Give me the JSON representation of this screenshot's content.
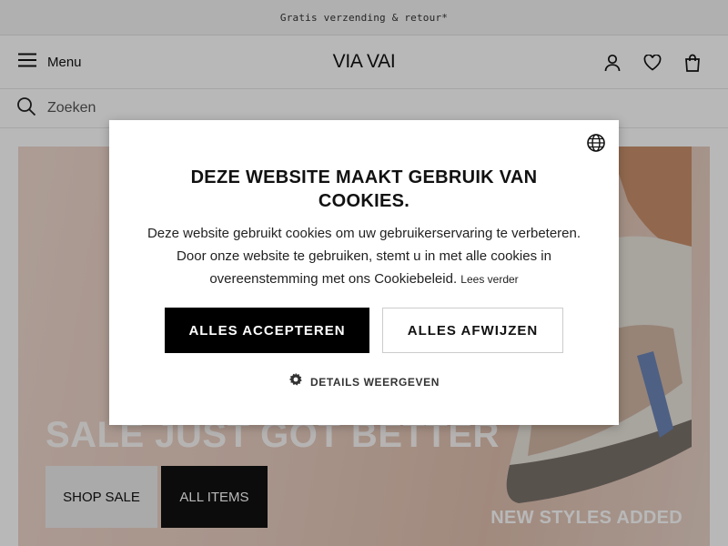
{
  "promo": {
    "text": "Gratis verzending & retour*"
  },
  "header": {
    "menu_label": "Menu",
    "logo": "VIA VAI",
    "icons": [
      "menu-icon",
      "account-icon",
      "heart-icon",
      "bag-icon"
    ]
  },
  "search": {
    "placeholder": "Zoeken",
    "icon": "search-icon"
  },
  "hero": {
    "title": "SALE JUST GOT BETTER",
    "buttons": {
      "shop_sale": "SHOP SALE",
      "all_items": "ALL ITEMS"
    },
    "subtitle": "NEW STYLES ADDED"
  },
  "cookie_modal": {
    "title": "DEZE WEBSITE MAAKT GEBRUIK VAN COOKIES.",
    "body": "Deze website gebruikt cookies om uw gebruikerservaring te verbeteren. Door onze website te gebruiken, stemt u in met alle cookies in overeenstemming met ons Cookiebeleid.",
    "read_more": "Lees verder",
    "accept_label": "ALLES ACCEPTEREN",
    "reject_label": "ALLES AFWIJZEN",
    "details_label": "DETAILS WEERGEVEN",
    "icons": [
      "globe-icon",
      "gear-icon"
    ]
  },
  "colors": {
    "accept_bg": "#000000",
    "hero_bg": "#e7cbbd"
  }
}
